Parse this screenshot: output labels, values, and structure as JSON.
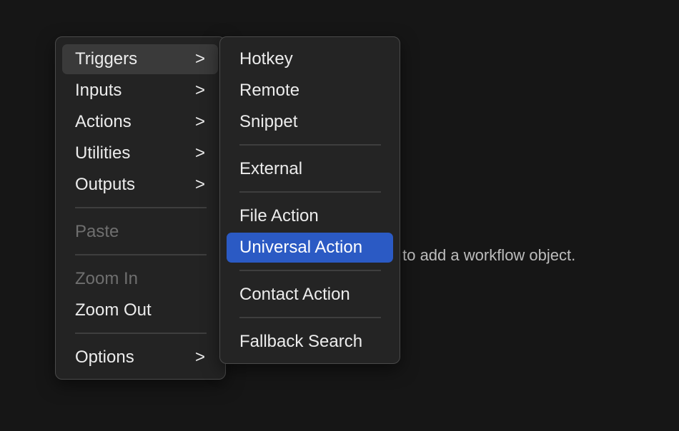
{
  "canvas_hint": "ck to add a workflow object.",
  "main_menu": {
    "items": [
      {
        "label": "Triggers",
        "submenu": true,
        "state": "hover"
      },
      {
        "label": "Inputs",
        "submenu": true
      },
      {
        "label": "Actions",
        "submenu": true
      },
      {
        "label": "Utilities",
        "submenu": true
      },
      {
        "label": "Outputs",
        "submenu": true
      },
      {
        "label": "Paste",
        "disabled": true
      },
      {
        "label": "Zoom In",
        "disabled": true
      },
      {
        "label": "Zoom Out"
      },
      {
        "label": "Options",
        "submenu": true
      }
    ],
    "chevron": "›"
  },
  "triggers_submenu": {
    "items": [
      {
        "label": "Hotkey"
      },
      {
        "label": "Remote"
      },
      {
        "label": "Snippet"
      },
      {
        "label": "External"
      },
      {
        "label": "File Action"
      },
      {
        "label": "Universal Action",
        "state": "selected"
      },
      {
        "label": "Contact Action"
      },
      {
        "label": "Fallback Search"
      }
    ]
  },
  "colors": {
    "selection": "#2b5ac4",
    "background": "#161616",
    "menu": "#232323"
  }
}
